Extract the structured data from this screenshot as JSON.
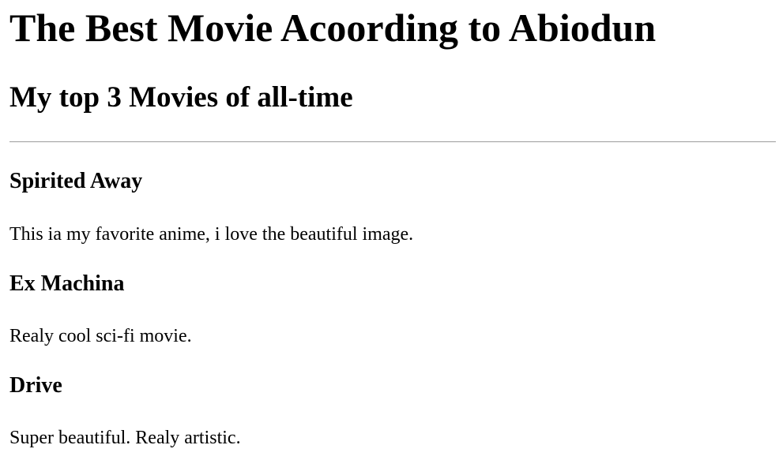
{
  "header": {
    "title": "The Best Movie Acoording to Abiodun",
    "subtitle": "My top 3 Movies of all-time"
  },
  "movies": [
    {
      "title": "Spirited Away",
      "description": "This ia my favorite anime, i love the beautiful image."
    },
    {
      "title": "Ex Machina",
      "description": "Realy cool sci-fi movie."
    },
    {
      "title": "Drive",
      "description": "Super beautiful. Realy artistic."
    }
  ]
}
